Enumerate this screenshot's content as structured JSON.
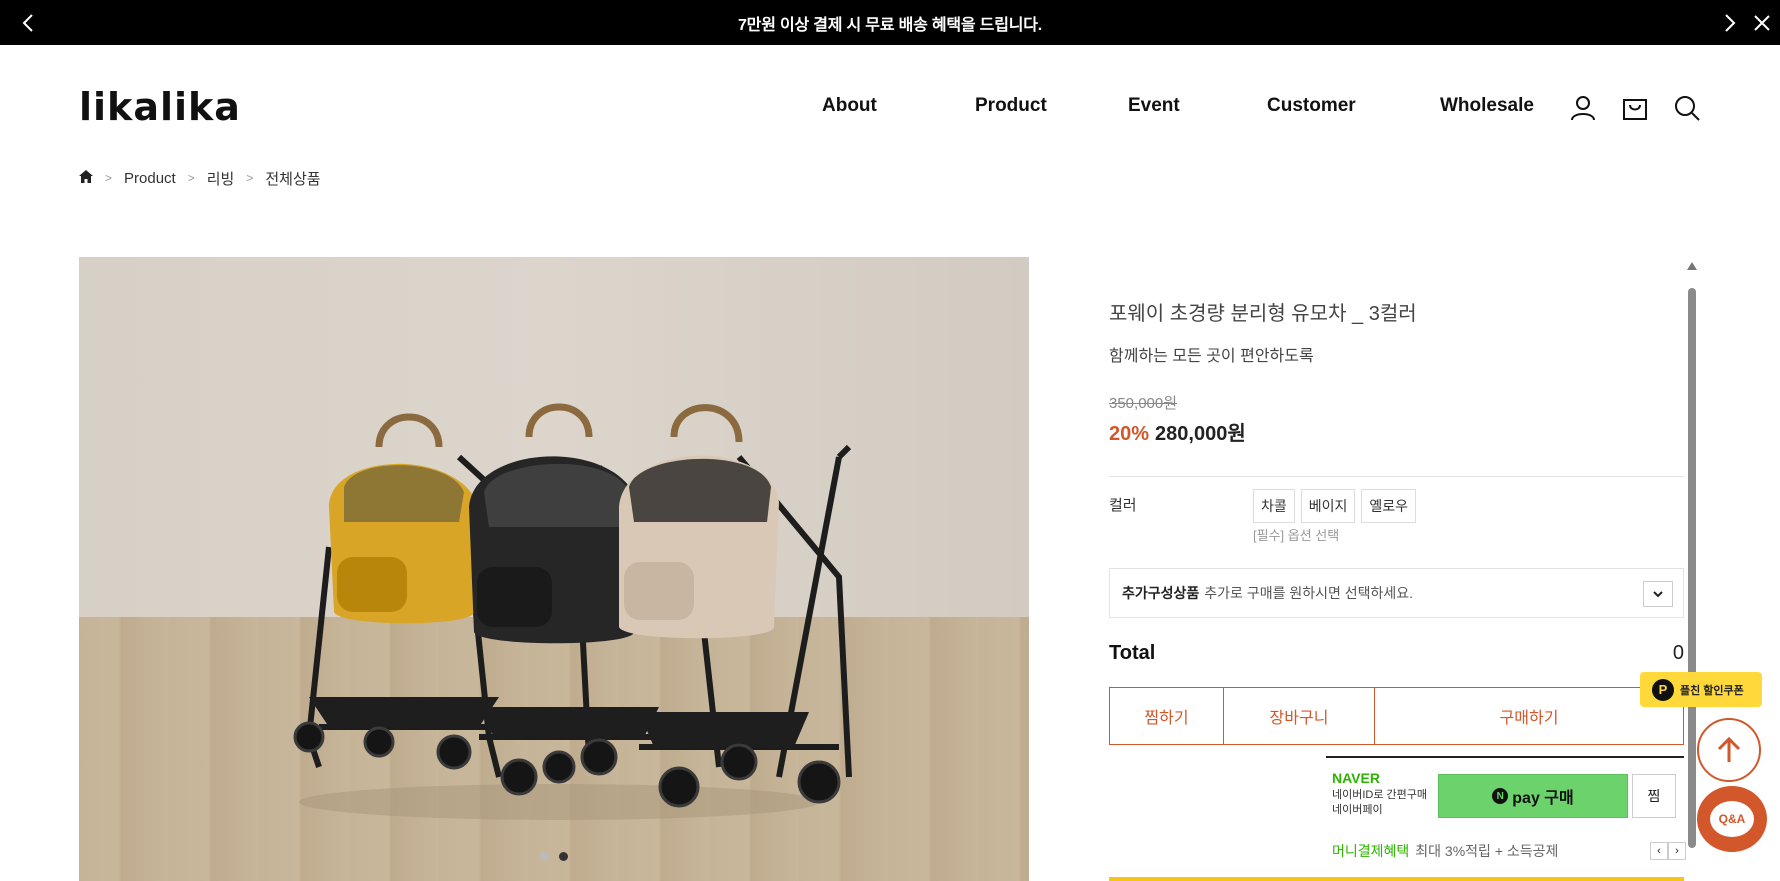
{
  "topbar": {
    "message": "7만원 이상 결제 시 무료 배송 혜택을 드립니다.",
    "prev_icon": "chevron-left-icon",
    "next_icon": "chevron-right-icon",
    "close_icon": "close-icon"
  },
  "header": {
    "logo": "likalika",
    "nav": [
      "About",
      "Product",
      "Event",
      "Customer",
      "Wholesale"
    ],
    "icons": [
      "user-icon",
      "cart-icon",
      "search-icon"
    ]
  },
  "breadcrumb": {
    "home_icon": "home-icon",
    "items": [
      "Product",
      "리빙",
      "전체상품"
    ]
  },
  "gallery": {
    "slide_count": 2,
    "active_slide": 2
  },
  "product": {
    "name": "포웨이 초경량 분리형 유모차 _ 3컬러",
    "subtitle": "함께하는 모든 곳이 편안하도록",
    "original_price": "350,000원",
    "discount": "20%",
    "price": "280,000원",
    "option_label": "컬러",
    "options": [
      "차콜",
      "베이지",
      "옐로우"
    ],
    "option_hint": "[필수] 옵션 선택",
    "addon_title": "추가구성상품",
    "addon_text": "추가로 구매를 원하시면 선택하세요.",
    "total_label": "Total",
    "total_value": "0",
    "actions": {
      "wish": "찜하기",
      "cart": "장바구니",
      "buy": "구매하기"
    }
  },
  "npay": {
    "brand": "NAVER",
    "sub1": "네이버ID로 간편구매",
    "sub2": "네이버페이",
    "button": "pay 구매",
    "jjim": "찜",
    "money_label": "머니결제혜택",
    "money_text": "최대 3%적립 + 소득공제"
  },
  "floating": {
    "coupon": "플친 할인쿠폰",
    "qna": "Q&A"
  },
  "colors": {
    "accent": "#d2572b",
    "naver_green": "#2db400",
    "npay_button": "#6cd36c",
    "coupon_yellow": "#ffd83a"
  }
}
